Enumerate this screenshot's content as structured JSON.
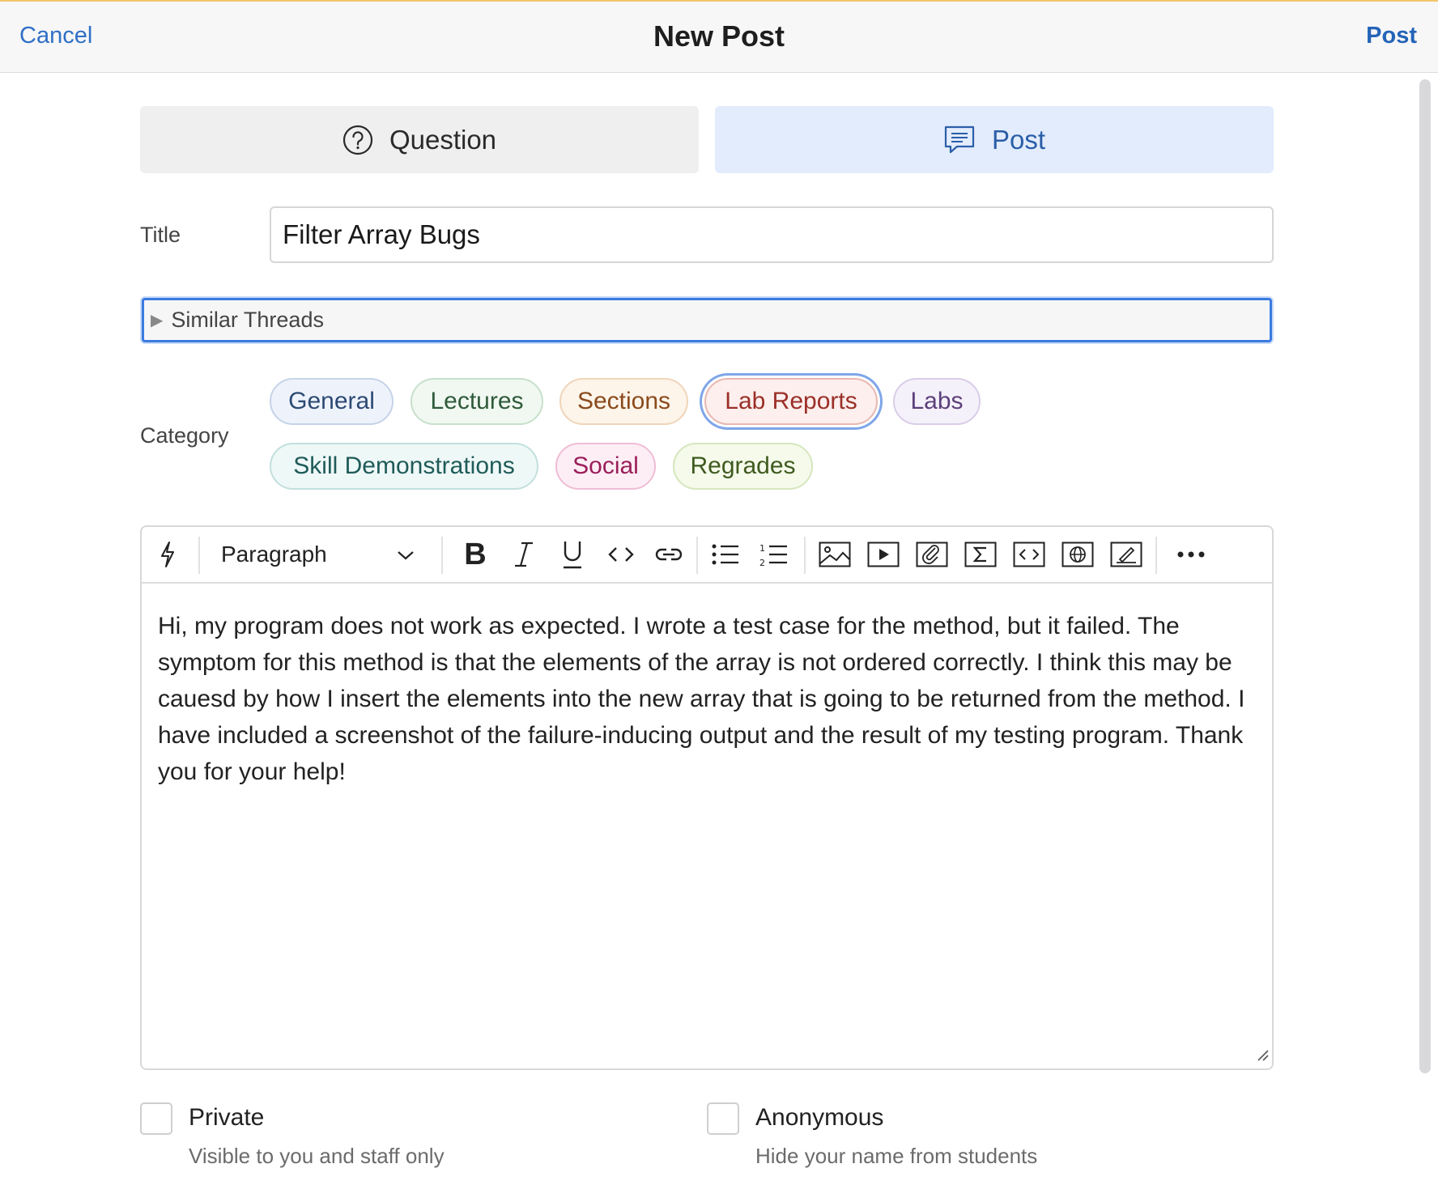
{
  "header": {
    "cancel_label": "Cancel",
    "title": "New Post",
    "post_label": "Post"
  },
  "post_type": {
    "question_label": "Question",
    "post_label": "Post",
    "selected": "Post"
  },
  "form": {
    "title_label": "Title",
    "title_value": "Filter Array Bugs",
    "similar_threads_label": "Similar Threads",
    "category_label": "Category"
  },
  "categories": [
    {
      "label": "General",
      "color": "#2d4a73",
      "bg": "#eef3fb",
      "border": "#c5d3e8"
    },
    {
      "label": "Lectures",
      "color": "#2f5a3a",
      "bg": "#f0f8f1",
      "border": "#c7e0cb"
    },
    {
      "label": "Sections",
      "color": "#8a4a1c",
      "bg": "#fdf4ea",
      "border": "#f0d5b8"
    },
    {
      "label": "Lab Reports",
      "color": "#9b2f28",
      "bg": "#fcefed",
      "border": "#e8b7b1",
      "selected": true
    },
    {
      "label": "Labs",
      "color": "#5b3f7a",
      "bg": "#f5f1fa",
      "border": "#d9cde8"
    },
    {
      "label": "Skill Demonstrations",
      "color": "#1f5b58",
      "bg": "#eef8f7",
      "border": "#c2e0dc"
    },
    {
      "label": "Social",
      "color": "#9a1f5a",
      "bg": "#fdeef5",
      "border": "#efbdd5"
    },
    {
      "label": "Regrades",
      "color": "#3f5a1f",
      "bg": "#f5faeb",
      "border": "#d6e6bd"
    }
  ],
  "editor": {
    "block_format": "Paragraph",
    "body": "Hi, my program does not work as expected. I wrote a test case for the method, but it failed. The symptom for this method is that the elements of the array is not ordered correctly. I think this may be cauesd by how I insert the elements into the new array that is going to be returned from the method. I have included a screenshot of the failure-inducing output and the result of my testing program. Thank you for your help!",
    "toolbar_icons": [
      "lightning-icon",
      "bold-icon",
      "italic-icon",
      "underline-icon",
      "inline-code-icon",
      "link-icon",
      "bullet-list-icon",
      "numbered-list-icon",
      "image-icon",
      "video-icon",
      "attachment-icon",
      "math-icon",
      "code-block-icon",
      "web-embed-icon",
      "drawing-icon",
      "more-icon"
    ]
  },
  "options": {
    "private_label": "Private",
    "private_desc": "Visible to you and staff only",
    "private_checked": false,
    "anonymous_label": "Anonymous",
    "anonymous_desc": "Hide your name from students",
    "anonymous_checked": false
  },
  "colors": {
    "accent": "#2f6fc6",
    "selected_tab_bg": "#e3ecfc",
    "focus_outline": "#3a7be0"
  }
}
